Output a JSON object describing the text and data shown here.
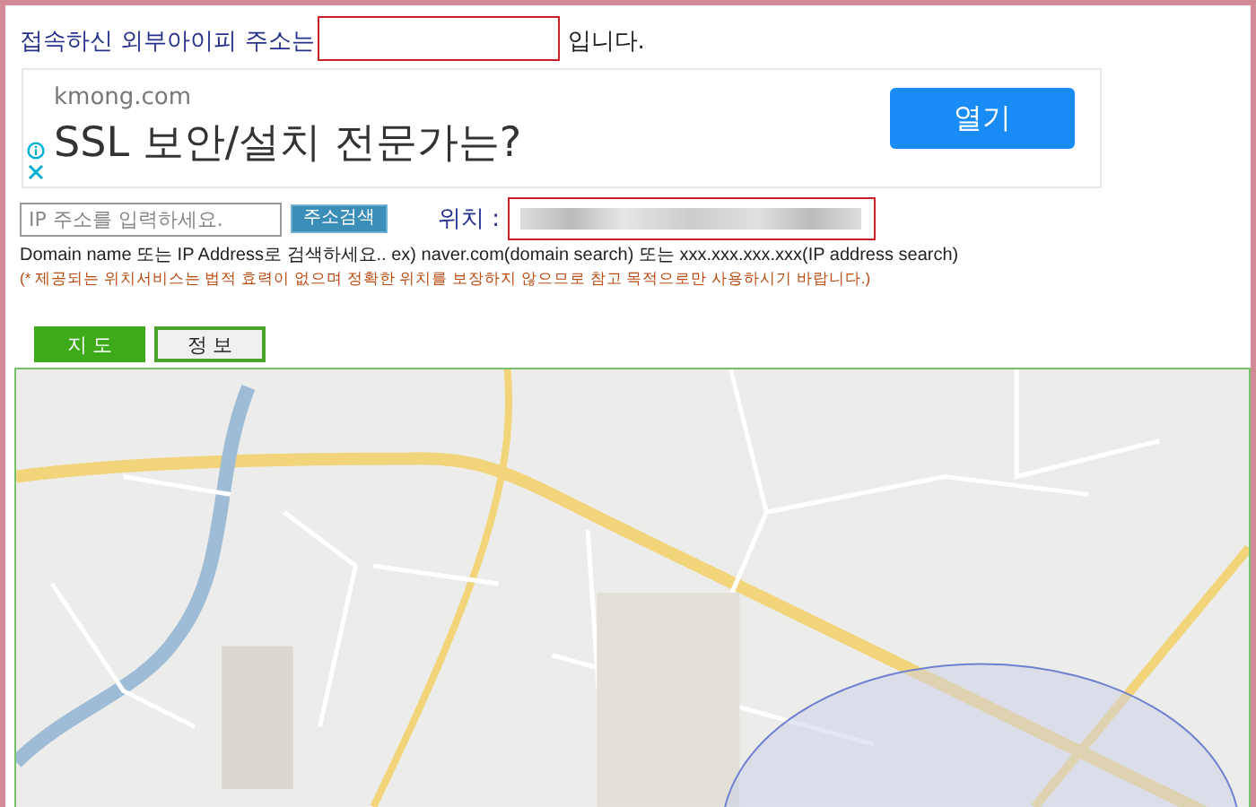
{
  "ip_line": {
    "label": "접속하신 외부아이피 주소는",
    "suffix": "입니다."
  },
  "ad": {
    "domain": "kmong.com",
    "headline": "SSL 보안/설치 전문가는?",
    "button": "열기"
  },
  "search": {
    "placeholder": "IP 주소를 입력하세요.",
    "button": "주소검색",
    "location_label": "위치 :"
  },
  "help": "Domain name 또는 IP Address로 검색하세요.. ex) naver.com(domain search) 또는 xxx.xxx.xxx.xxx(IP address search)",
  "notice": "(* 제공되는 위치서비스는 법적 효력이 없으며 정확한 위치를 보장하지 않으므로 참고 목적으로만 사용하시기 바랍니다.)",
  "tabs": [
    {
      "label": "지 도",
      "selected": true
    },
    {
      "label": "정 보",
      "selected": false
    }
  ]
}
